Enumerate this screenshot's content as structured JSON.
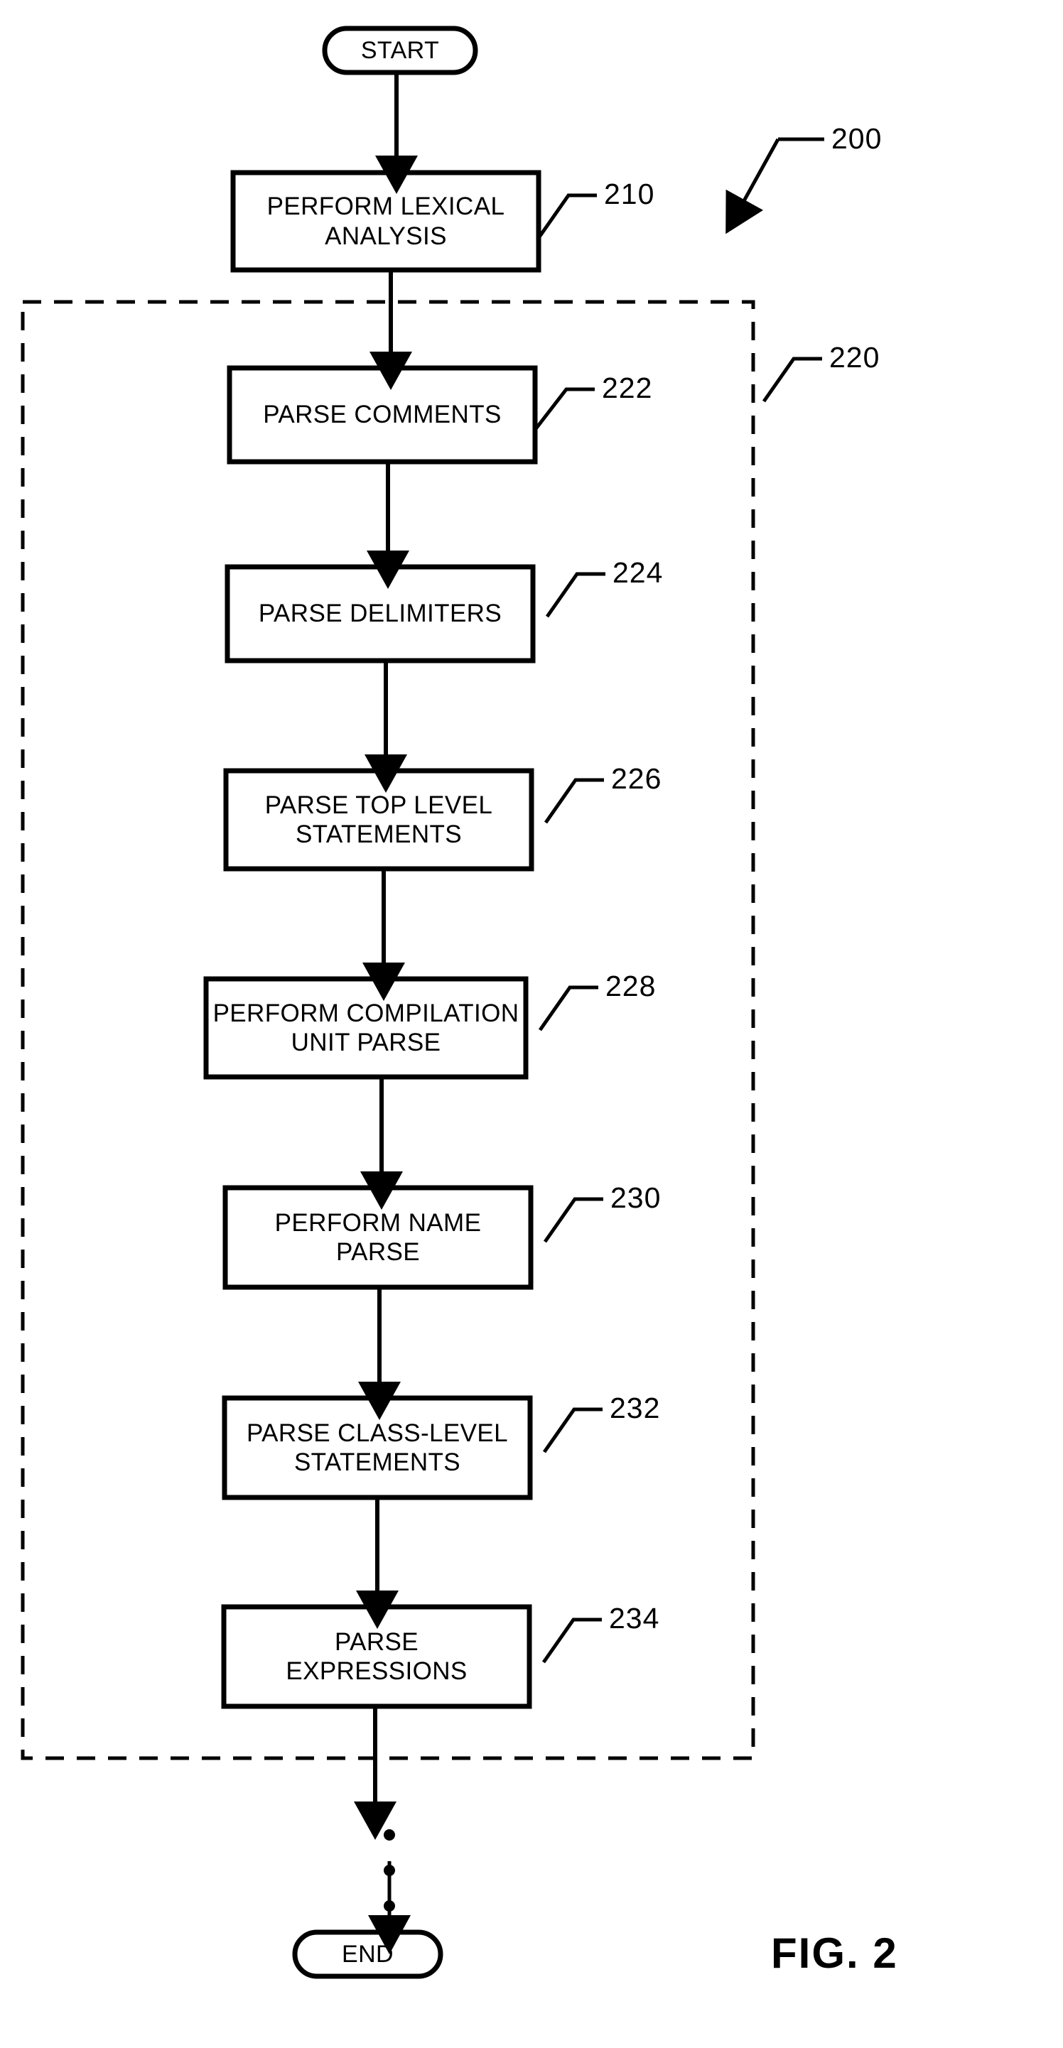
{
  "figure": {
    "caption": "FIG. 2",
    "diagram_ref": "200",
    "group_ref": "220"
  },
  "terminators": {
    "start": "START",
    "end": "END"
  },
  "nodes": [
    {
      "id": "210",
      "label": "PERFORM LEXICAL\nANALYSIS",
      "ref": "210"
    },
    {
      "id": "222",
      "label": "PARSE COMMENTS",
      "ref": "222"
    },
    {
      "id": "224",
      "label": "PARSE DELIMITERS",
      "ref": "224"
    },
    {
      "id": "226",
      "label": "PARSE TOP LEVEL\nSTATEMENTS",
      "ref": "226"
    },
    {
      "id": "228",
      "label": "PERFORM COMPILATION\nUNIT PARSE",
      "ref": "228"
    },
    {
      "id": "230",
      "label": "PERFORM NAME\nPARSE",
      "ref": "230"
    },
    {
      "id": "232",
      "label": "PARSE CLASS-LEVEL\nSTATEMENTS",
      "ref": "232"
    },
    {
      "id": "234",
      "label": "PARSE\nEXPRESSIONS",
      "ref": "234"
    }
  ],
  "colors": {
    "ink": "#000000",
    "paper": "#ffffff"
  }
}
